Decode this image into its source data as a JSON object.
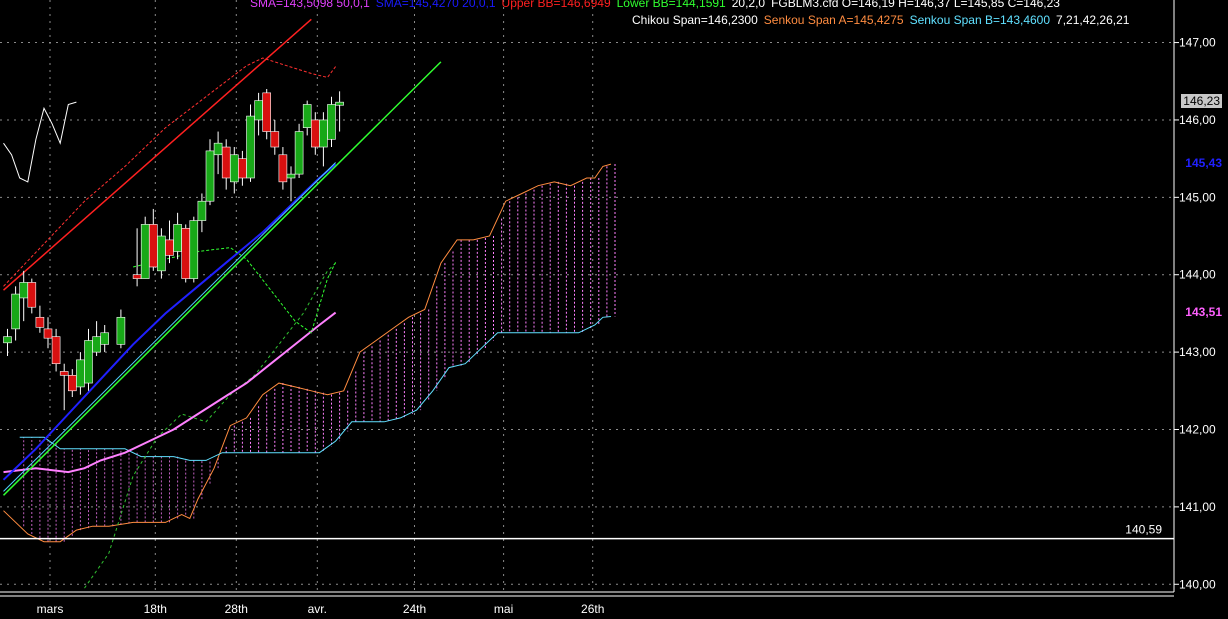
{
  "header": {
    "line1": [
      {
        "text": "SMA=143,5098  50,0,1",
        "color": "#e040fb"
      },
      {
        "text": "SMA=145,4270  20,0,1",
        "color": "#1a1aff"
      },
      {
        "text": "Upper BB=146,6949",
        "color": "#ff2020"
      },
      {
        "text": "Lower BB=144,1591",
        "color": "#30ff30"
      },
      {
        "text": "20,2,0",
        "color": "#ffffff"
      },
      {
        "text": "FGBLM3.cfd O=146,19 H=146,37 L=145,85 C=146,23",
        "color": "#ffffff"
      }
    ],
    "line2": [
      {
        "text": "Chikou Span=146,2300",
        "color": "#ffffff"
      },
      {
        "text": "Senkou Span A=145,4275",
        "color": "#ff8c40"
      },
      {
        "text": "Senkou Span B=143,4600",
        "color": "#60e0ff"
      },
      {
        "text": "7,21,42,26,21",
        "color": "#ffffff"
      }
    ]
  },
  "price_tags": [
    {
      "text": "146,23",
      "value": 146.23,
      "color": "#000000",
      "bg": "#c8c8c8"
    },
    {
      "text": "145,43",
      "value": 145.43,
      "color": "#2020ff",
      "bg": ""
    },
    {
      "text": "143,51",
      "value": 143.51,
      "color": "#ff60ff",
      "bg": ""
    }
  ],
  "hline": {
    "value": 140.59,
    "label": "140,59"
  },
  "chart_data": {
    "type": "candlestick",
    "y_ticks": [
      {
        "v": 147.0,
        "label": "147,00"
      },
      {
        "v": 146.0,
        "label": "146,00"
      },
      {
        "v": 145.0,
        "label": "145,00"
      },
      {
        "v": 144.0,
        "label": "144,00"
      },
      {
        "v": 143.0,
        "label": "143,00"
      },
      {
        "v": 142.0,
        "label": "142,00"
      },
      {
        "v": 141.0,
        "label": "141,00"
      },
      {
        "v": 140.0,
        "label": "140,00"
      }
    ],
    "ylim": [
      139.9,
      147.55
    ],
    "x_count": 98,
    "x_ticks": [
      {
        "i": 5,
        "label": "mars"
      },
      {
        "i": 18,
        "label": "18th"
      },
      {
        "i": 28,
        "label": "28th"
      },
      {
        "i": 38,
        "label": "avr."
      },
      {
        "i": 50,
        "label": "24th"
      },
      {
        "i": 61,
        "label": "mai"
      },
      {
        "i": 72,
        "label": "26th"
      }
    ],
    "candles": [
      {
        "i": 0,
        "o": 143.12,
        "h": 143.3,
        "l": 142.95,
        "c": 143.2
      },
      {
        "i": 1,
        "o": 143.3,
        "h": 143.85,
        "l": 143.15,
        "c": 143.75
      },
      {
        "i": 2,
        "o": 143.7,
        "h": 144.05,
        "l": 143.4,
        "c": 143.9
      },
      {
        "i": 3,
        "o": 143.9,
        "h": 143.95,
        "l": 143.5,
        "c": 143.58
      },
      {
        "i": 4,
        "o": 143.45,
        "h": 143.6,
        "l": 143.25,
        "c": 143.32
      },
      {
        "i": 5,
        "o": 143.3,
        "h": 143.45,
        "l": 143.05,
        "c": 143.18
      },
      {
        "i": 6,
        "o": 143.2,
        "h": 143.3,
        "l": 142.75,
        "c": 142.85
      },
      {
        "i": 7,
        "o": 142.75,
        "h": 142.85,
        "l": 142.25,
        "c": 142.7
      },
      {
        "i": 8,
        "o": 142.7,
        "h": 142.78,
        "l": 142.42,
        "c": 142.5
      },
      {
        "i": 9,
        "o": 142.55,
        "h": 143.0,
        "l": 142.45,
        "c": 142.9
      },
      {
        "i": 10,
        "o": 142.6,
        "h": 143.3,
        "l": 142.5,
        "c": 143.15
      },
      {
        "i": 11,
        "o": 143.0,
        "h": 143.4,
        "l": 142.95,
        "c": 143.2
      },
      {
        "i": 12,
        "o": 143.1,
        "h": 143.35,
        "l": 143.0,
        "c": 143.25
      },
      {
        "i": 14,
        "o": 143.1,
        "h": 143.55,
        "l": 143.05,
        "c": 143.45
      },
      {
        "i": 16,
        "o": 144.0,
        "h": 144.6,
        "l": 143.85,
        "c": 143.95
      },
      {
        "i": 17,
        "o": 143.95,
        "h": 144.75,
        "l": 143.95,
        "c": 144.65
      },
      {
        "i": 18,
        "o": 144.65,
        "h": 144.85,
        "l": 144.05,
        "c": 144.1
      },
      {
        "i": 19,
        "o": 144.05,
        "h": 144.6,
        "l": 143.95,
        "c": 144.5
      },
      {
        "i": 20,
        "o": 144.45,
        "h": 144.7,
        "l": 144.15,
        "c": 144.25
      },
      {
        "i": 21,
        "o": 144.3,
        "h": 144.8,
        "l": 144.2,
        "c": 144.65
      },
      {
        "i": 22,
        "o": 144.6,
        "h": 144.65,
        "l": 143.9,
        "c": 143.95
      },
      {
        "i": 23,
        "o": 143.95,
        "h": 144.75,
        "l": 143.9,
        "c": 144.7
      },
      {
        "i": 24,
        "o": 144.7,
        "h": 145.05,
        "l": 144.55,
        "c": 144.95
      },
      {
        "i": 25,
        "o": 144.95,
        "h": 145.75,
        "l": 144.9,
        "c": 145.6
      },
      {
        "i": 26,
        "o": 145.55,
        "h": 145.85,
        "l": 145.3,
        "c": 145.7
      },
      {
        "i": 27,
        "o": 145.65,
        "h": 145.75,
        "l": 145.1,
        "c": 145.25
      },
      {
        "i": 28,
        "o": 145.2,
        "h": 145.65,
        "l": 145.05,
        "c": 145.55
      },
      {
        "i": 29,
        "o": 145.5,
        "h": 145.6,
        "l": 145.15,
        "c": 145.25
      },
      {
        "i": 30,
        "o": 145.25,
        "h": 146.2,
        "l": 145.2,
        "c": 146.05
      },
      {
        "i": 31,
        "o": 146.0,
        "h": 146.35,
        "l": 145.8,
        "c": 146.25
      },
      {
        "i": 32,
        "o": 146.35,
        "h": 146.4,
        "l": 145.75,
        "c": 145.85
      },
      {
        "i": 33,
        "o": 145.85,
        "h": 146.0,
        "l": 145.55,
        "c": 145.65
      },
      {
        "i": 34,
        "o": 145.55,
        "h": 145.65,
        "l": 145.1,
        "c": 145.2
      },
      {
        "i": 35,
        "o": 145.25,
        "h": 145.4,
        "l": 144.95,
        "c": 145.3
      },
      {
        "i": 36,
        "o": 145.3,
        "h": 145.95,
        "l": 145.25,
        "c": 145.85
      },
      {
        "i": 37,
        "o": 145.9,
        "h": 146.25,
        "l": 145.8,
        "c": 146.2
      },
      {
        "i": 38,
        "o": 146.0,
        "h": 146.1,
        "l": 145.55,
        "c": 145.65
      },
      {
        "i": 39,
        "o": 145.65,
        "h": 146.1,
        "l": 145.4,
        "c": 146.0
      },
      {
        "i": 40,
        "o": 145.75,
        "h": 146.3,
        "l": 145.65,
        "c": 146.2
      },
      {
        "i": 41,
        "o": 146.19,
        "h": 146.37,
        "l": 145.85,
        "c": 146.23
      }
    ],
    "upper_bb": [
      [
        0,
        143.85
      ],
      [
        5,
        144.4
      ],
      [
        10,
        144.95
      ],
      [
        15,
        145.4
      ],
      [
        20,
        145.9
      ],
      [
        25,
        146.3
      ],
      [
        30,
        146.7
      ],
      [
        32,
        146.8
      ],
      [
        35,
        146.7
      ],
      [
        38,
        146.6
      ],
      [
        40,
        146.55
      ],
      [
        41,
        146.69
      ]
    ],
    "lower_bb": [
      [
        16,
        144.1
      ],
      [
        20,
        144.2
      ],
      [
        24,
        144.3
      ],
      [
        28,
        144.35
      ],
      [
        30,
        144.2
      ],
      [
        33,
        143.8
      ],
      [
        36,
        143.4
      ],
      [
        38,
        143.25
      ],
      [
        40,
        143.95
      ],
      [
        41,
        144.16
      ]
    ],
    "sma50": [
      [
        0,
        141.45
      ],
      [
        4,
        141.5
      ],
      [
        8,
        141.45
      ],
      [
        10,
        141.5
      ],
      [
        12,
        141.6
      ],
      [
        15,
        141.7
      ],
      [
        18,
        141.85
      ],
      [
        21,
        142.0
      ],
      [
        24,
        142.2
      ],
      [
        27,
        142.4
      ],
      [
        30,
        142.6
      ],
      [
        33,
        142.85
      ],
      [
        36,
        143.1
      ],
      [
        39,
        143.35
      ],
      [
        41,
        143.51
      ]
    ],
    "sma20_blue": [
      [
        0,
        141.35
      ],
      [
        4,
        141.75
      ],
      [
        8,
        142.2
      ],
      [
        12,
        142.65
      ],
      [
        16,
        143.1
      ],
      [
        20,
        143.5
      ],
      [
        24,
        143.85
      ],
      [
        28,
        144.2
      ],
      [
        32,
        144.55
      ],
      [
        36,
        144.95
      ],
      [
        39,
        145.25
      ],
      [
        41,
        145.43
      ]
    ],
    "cyan_trend": [
      [
        0,
        141.2
      ],
      [
        41,
        145.45
      ]
    ],
    "green_trend": [
      [
        0,
        141.15
      ],
      [
        54,
        146.75
      ]
    ],
    "red_trend": [
      [
        0,
        143.8
      ],
      [
        38,
        147.3
      ]
    ],
    "chikou": [
      [
        0,
        145.7
      ],
      [
        1,
        145.55
      ],
      [
        2,
        145.25
      ],
      [
        3,
        145.2
      ],
      [
        4,
        145.75
      ],
      [
        5,
        146.15
      ],
      [
        6,
        145.95
      ],
      [
        7,
        145.7
      ],
      [
        8,
        146.2
      ],
      [
        9,
        146.23
      ]
    ],
    "chikou_green": [
      [
        10,
        139.95
      ],
      [
        13,
        140.4
      ],
      [
        16,
        141.4
      ],
      [
        19,
        141.9
      ],
      [
        22,
        142.2
      ],
      [
        25,
        142.1
      ],
      [
        28,
        142.45
      ],
      [
        31,
        142.7
      ],
      [
        34,
        143.1
      ],
      [
        37,
        143.5
      ],
      [
        40,
        144.05
      ],
      [
        41,
        144.15
      ]
    ],
    "senkou_a": [
      [
        0,
        140.95
      ],
      [
        3,
        140.65
      ],
      [
        5,
        140.55
      ],
      [
        7,
        140.55
      ],
      [
        9,
        140.7
      ],
      [
        11,
        140.75
      ],
      [
        13,
        140.75
      ],
      [
        16,
        140.8
      ],
      [
        18,
        140.8
      ],
      [
        20,
        140.8
      ],
      [
        22,
        140.9
      ],
      [
        23,
        140.85
      ],
      [
        24,
        141.1
      ],
      [
        26,
        141.5
      ],
      [
        28,
        142.05
      ],
      [
        30,
        142.15
      ],
      [
        32,
        142.45
      ],
      [
        34,
        142.6
      ],
      [
        36,
        142.55
      ],
      [
        38,
        142.5
      ],
      [
        40,
        142.45
      ],
      [
        42,
        142.5
      ],
      [
        44,
        143.0
      ],
      [
        46,
        143.15
      ],
      [
        48,
        143.3
      ],
      [
        50,
        143.45
      ],
      [
        52,
        143.55
      ],
      [
        54,
        144.15
      ],
      [
        56,
        144.45
      ],
      [
        58,
        144.45
      ],
      [
        60,
        144.5
      ],
      [
        62,
        144.95
      ],
      [
        64,
        145.05
      ],
      [
        66,
        145.15
      ],
      [
        68,
        145.2
      ],
      [
        70,
        145.15
      ],
      [
        72,
        145.25
      ],
      [
        73,
        145.25
      ],
      [
        74,
        145.4
      ],
      [
        75,
        145.43
      ]
    ],
    "senkou_b": [
      [
        2,
        141.9
      ],
      [
        5,
        141.9
      ],
      [
        7,
        141.75
      ],
      [
        9,
        141.75
      ],
      [
        11,
        141.75
      ],
      [
        13,
        141.75
      ],
      [
        15,
        141.75
      ],
      [
        17,
        141.65
      ],
      [
        19,
        141.65
      ],
      [
        21,
        141.65
      ],
      [
        23,
        141.6
      ],
      [
        25,
        141.6
      ],
      [
        27,
        141.7
      ],
      [
        29,
        141.7
      ],
      [
        31,
        141.7
      ],
      [
        33,
        141.7
      ],
      [
        35,
        141.7
      ],
      [
        37,
        141.7
      ],
      [
        39,
        141.7
      ],
      [
        41,
        141.85
      ],
      [
        43,
        142.1
      ],
      [
        45,
        142.1
      ],
      [
        47,
        142.1
      ],
      [
        49,
        142.15
      ],
      [
        51,
        142.25
      ],
      [
        53,
        142.5
      ],
      [
        55,
        142.8
      ],
      [
        57,
        142.85
      ],
      [
        59,
        143.05
      ],
      [
        61,
        143.25
      ],
      [
        63,
        143.25
      ],
      [
        65,
        143.25
      ],
      [
        67,
        143.25
      ],
      [
        69,
        143.25
      ],
      [
        71,
        143.25
      ],
      [
        73,
        143.35
      ],
      [
        74,
        143.45
      ],
      [
        75,
        143.46
      ]
    ]
  }
}
